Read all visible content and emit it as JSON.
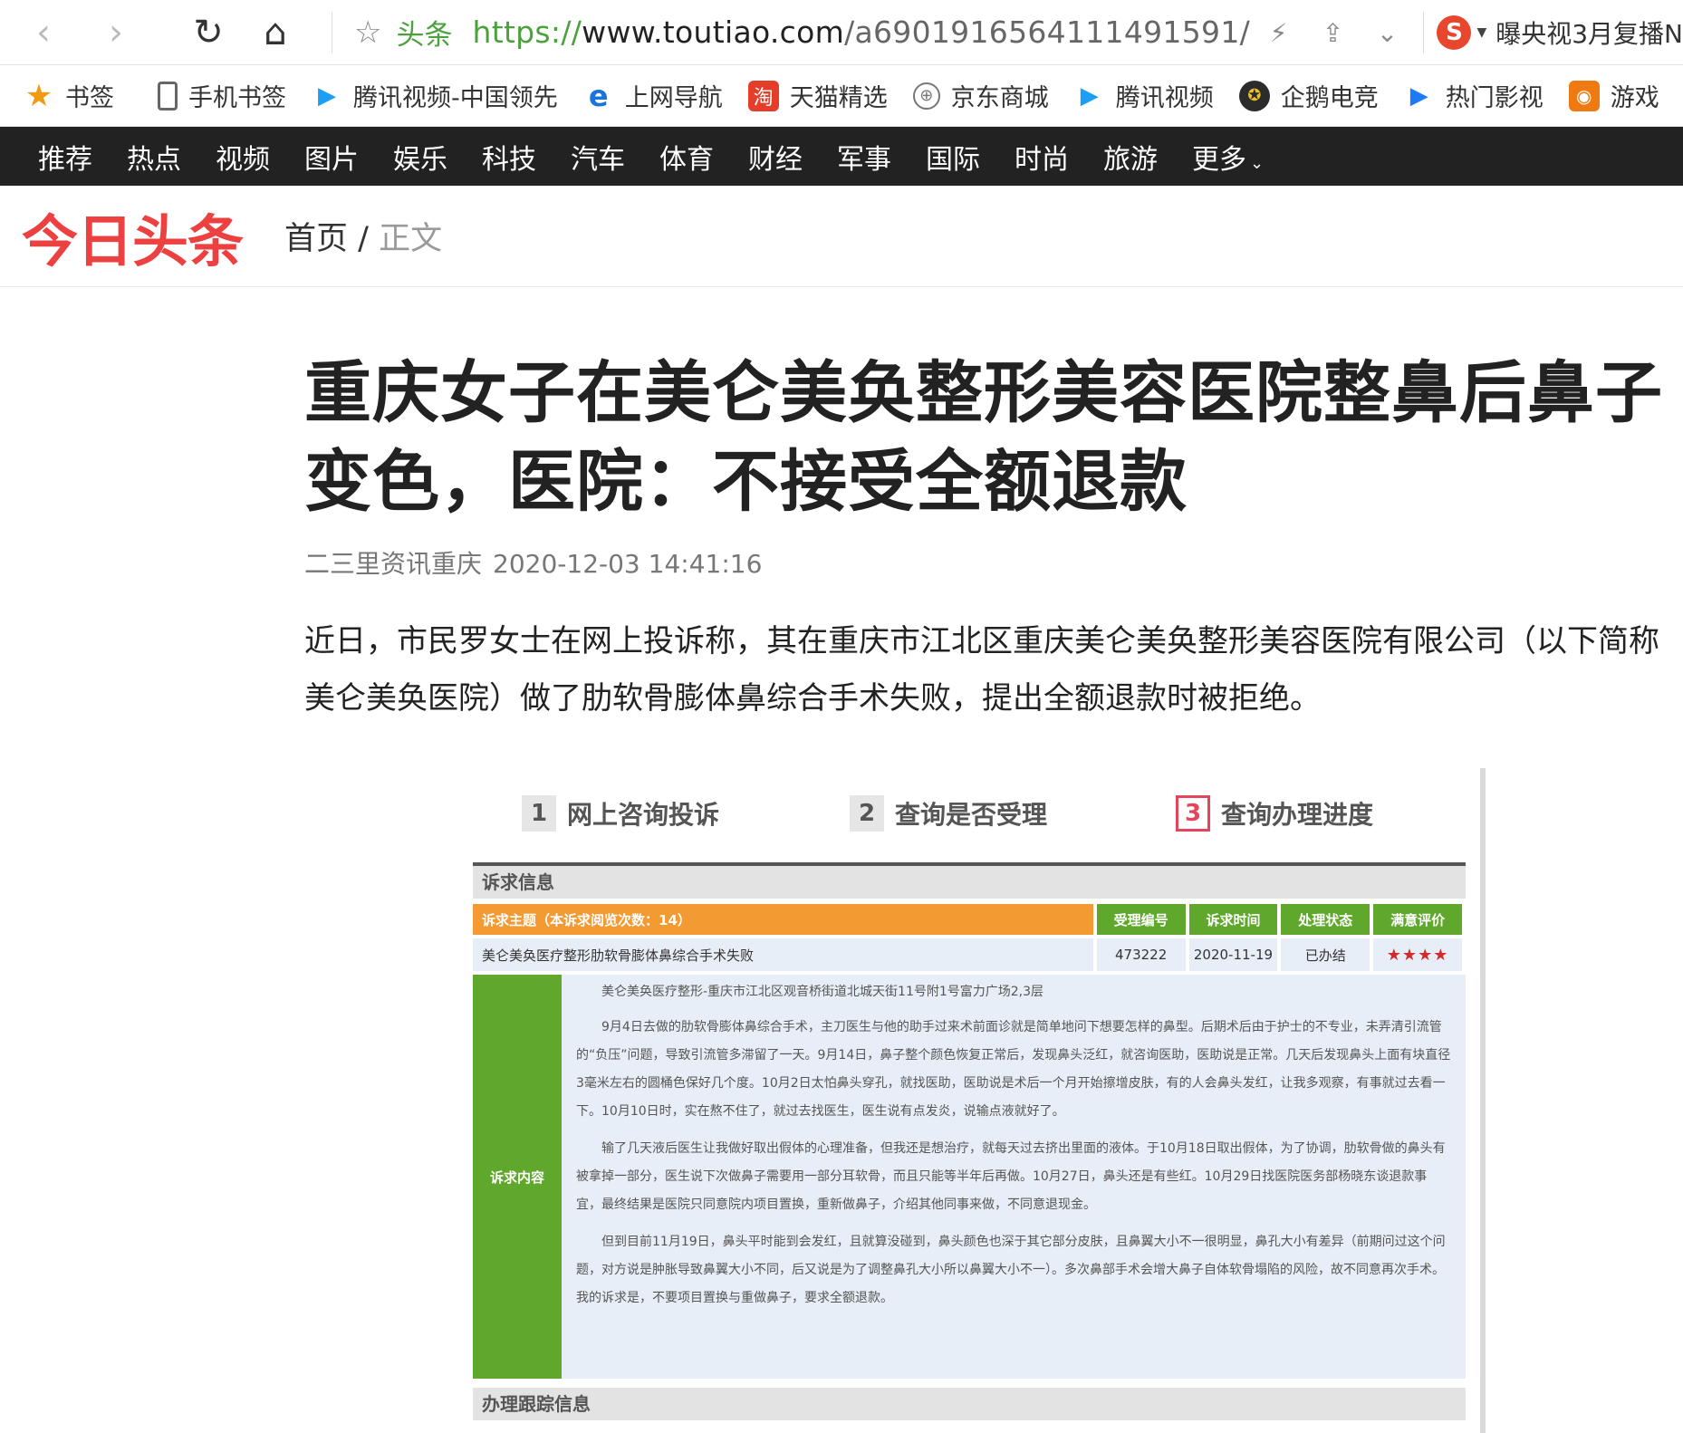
{
  "browser": {
    "site_tag": "头条",
    "url_scheme": "https://",
    "url_host": "www.toutiao.com",
    "url_path": "/a6901916564111491591/",
    "search_hint": "曝央视3月复播N"
  },
  "bookmarks": [
    {
      "label": "书签",
      "icon": "star-icon"
    },
    {
      "label": "手机书签",
      "icon": "phone-icon"
    },
    {
      "label": "腾讯视频-中国领先",
      "icon": "tencent-video-icon"
    },
    {
      "label": "上网导航",
      "icon": "ie-icon"
    },
    {
      "label": "天猫精选",
      "icon": "tmall-icon"
    },
    {
      "label": "京东商城",
      "icon": "globe-icon"
    },
    {
      "label": "腾讯视频",
      "icon": "tencent-video-icon"
    },
    {
      "label": "企鹅电竞",
      "icon": "esports-icon"
    },
    {
      "label": "热门影视",
      "icon": "film-icon"
    },
    {
      "label": "游戏",
      "icon": "game-icon"
    }
  ],
  "categories": [
    "推荐",
    "热点",
    "视频",
    "图片",
    "娱乐",
    "科技",
    "汽车",
    "体育",
    "财经",
    "军事",
    "国际",
    "时尚",
    "旅游",
    "更多"
  ],
  "header": {
    "logo": "今日头条",
    "crumb_home": "首页",
    "crumb_sep": "/",
    "crumb_current": "正文"
  },
  "article": {
    "title": "重庆女子在美仑美奂整形美容医院整鼻后鼻子变色，医院：不接受全额退款",
    "source": "二三里资讯重庆",
    "time": "2020-12-03 14:41:16",
    "lead": "近日，市民罗女士在网上投诉称，其在重庆市江北区重庆美仑美奂整形美容医院有限公司（以下简称美仑美奂医院）做了肋软骨膨体鼻综合手术失败，提出全额退款时被拒绝。"
  },
  "screenshot": {
    "steps": [
      {
        "num": "1",
        "label": "网上咨询投诉"
      },
      {
        "num": "2",
        "label": "查询是否受理"
      },
      {
        "num": "3",
        "label": "查询办理进度"
      }
    ],
    "section_title": "诉求信息",
    "headers": {
      "subject": "诉求主题（本诉求阅览次数：14）",
      "number": "受理编号",
      "time": "诉求时间",
      "status": "处理状态",
      "rating": "满意评价"
    },
    "row": {
      "subject": "美仑美奂医疗整形肋软骨膨体鼻综合手术失败",
      "number": "473222",
      "time": "2020-11-19",
      "status": "已办结",
      "rating": "★★★★"
    },
    "content_label": "诉求内容",
    "paragraphs": [
      "美仑美奂医疗整形-重庆市江北区观音桥街道北城天街11号附1号富力广场2,3层",
      "9月4日去做的肋软骨膨体鼻综合手术，主刀医生与他的助手过来术前面诊就是简单地问下想要怎样的鼻型。后期术后由于护士的不专业，未弄清引流管的“负压”问题，导致引流管多滞留了一天。9月14日，鼻子整个颜色恢复正常后，发现鼻头泛红，就咨询医助，医助说是正常。几天后发现鼻头上面有块直径3毫米左右的圆桶色保好几个度。10月2日太怕鼻头穿孔，就找医助，医助说是术后一个月开始擦增皮肤，有的人会鼻头发红，让我多观察，有事就过去看一下。10月10日时，实在熬不住了，就过去找医生，医生说有点发炎，说输点液就好了。",
      "输了几天液后医生让我做好取出假体的心理准备，但我还是想治疗，就每天过去挤出里面的液体。于10月18日取出假体，为了协调，肋软骨做的鼻头有被拿掉一部分，医生说下次做鼻子需要用一部分耳软骨，而且只能等半年后再做。10月27日，鼻头还是有些红。10月29日找医院医务部杨晓东谈退款事宜，最终结果是医院只同意院内项目置换，重新做鼻子，介绍其他同事来做，不同意退现金。",
      "但到目前11月19日，鼻头平时能到会发红，且就算没碰到，鼻头颜色也深于其它部分皮肤，且鼻翼大小不一很明显，鼻孔大小有差异（前期问过这个问题，对方说是肿胀导致鼻翼大小不同，后又说是为了调整鼻孔大小所以鼻翼大小不一）。多次鼻部手术会增大鼻子自体软骨塌陷的风险，故不同意再次手术。我的诉求是，不要项目置换与重做鼻子，要求全额退款。"
    ],
    "section2_title": "办理跟踪信息"
  }
}
